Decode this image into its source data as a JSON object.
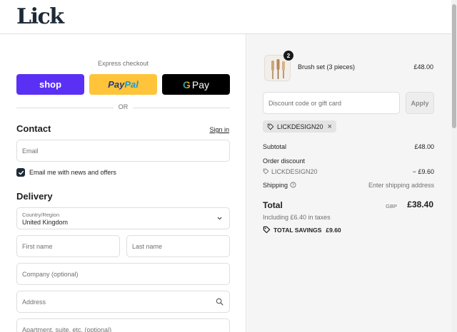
{
  "header": {
    "logo": "Lick"
  },
  "checkout": {
    "express_label": "Express checkout",
    "shop_label": "shop",
    "paypal_pay": "Pay",
    "paypal_pal": "Pal",
    "gpay_g": "G",
    "gpay_label": "Pay",
    "or_label": "OR"
  },
  "contact": {
    "title": "Contact",
    "sign_in": "Sign in",
    "email_placeholder": "Email",
    "newsletter_label": "Email me with news and offers",
    "newsletter_checked": true
  },
  "delivery": {
    "title": "Delivery",
    "country_label": "Country/Region",
    "country_value": "United Kingdom",
    "first_name_placeholder": "First name",
    "last_name_placeholder": "Last name",
    "company_placeholder": "Company (optional)",
    "address_placeholder": "Address",
    "apartment_placeholder": "Apartment, suite, etc. (optional)"
  },
  "order": {
    "item_name": "Brush set (3 pieces)",
    "item_price": "£48.00",
    "item_qty": "2",
    "discount_placeholder": "Discount code or gift card",
    "apply_label": "Apply",
    "applied_code": "LICKDESIGN20",
    "subtotal_label": "Subtotal",
    "subtotal_value": "£48.00",
    "order_discount_label": "Order discount",
    "discount_code": "LICKDESIGN20",
    "discount_value": "− £9.60",
    "shipping_label": "Shipping",
    "shipping_value": "Enter shipping address",
    "total_label": "Total",
    "currency": "GBP",
    "total_value": "£38.40",
    "tax_note": "Including £6.40 in taxes",
    "savings_label": "TOTAL SAVINGS",
    "savings_value": "£9.60"
  },
  "colors": {
    "shop": "#5a31f4",
    "paypal": "#ffc439",
    "gpay": "#000000",
    "brand": "#1e2a36"
  }
}
